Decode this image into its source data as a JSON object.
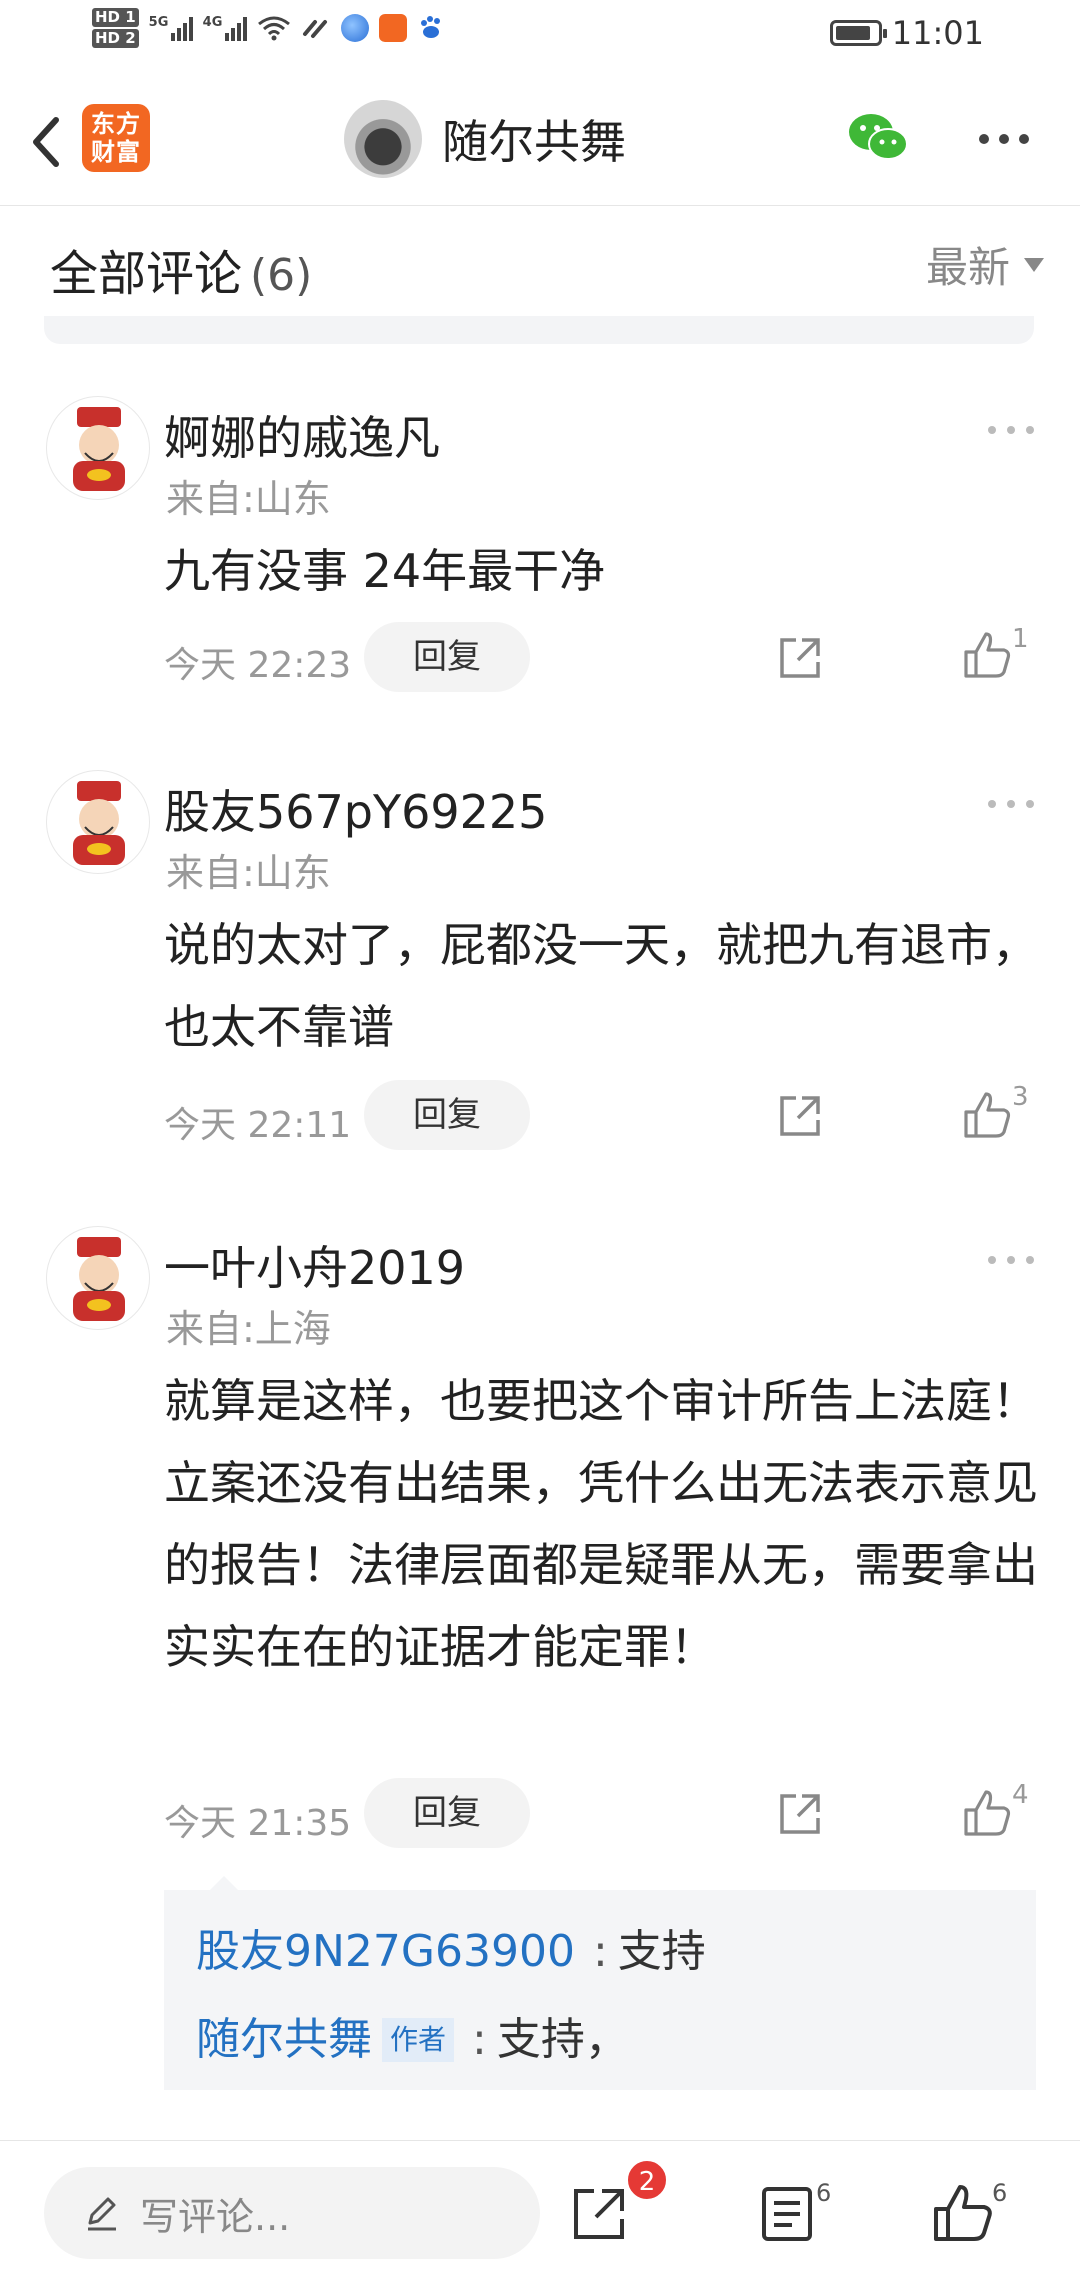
{
  "status_bar": {
    "hd1": "HD 1",
    "hd2": "HD 2",
    "sig1_label": "5G",
    "sig2_label": "4G",
    "time": "11:01"
  },
  "header": {
    "logo_text": "东方财富",
    "title": "随尔共舞"
  },
  "comments_header": {
    "title": "全部评论",
    "count": "(6)",
    "sort_label": "最新"
  },
  "comments": [
    {
      "name": "婀娜的戚逸凡",
      "from": "来自:山东",
      "text": "九有没事  24年最干净",
      "time": "今天 22:23",
      "reply_label": "回复",
      "likes": "1"
    },
    {
      "name": "股友567pY69225",
      "from": "来自:山东",
      "text": "说的太对了，屁都没一天，就把九有退市，也太不靠谱",
      "time": "今天 22:11",
      "reply_label": "回复",
      "likes": "3"
    },
    {
      "name": "一叶小舟2019",
      "from": "来自:上海",
      "text": "就算是这样，也要把这个审计所告上法庭！立案还没有出结果，凭什么出无法表示意见的报告！法律层面都是疑罪从无，需要拿出实实在在的证据才能定罪！",
      "time": "今天 21:35",
      "reply_label": "回复",
      "likes": "4"
    }
  ],
  "replies": [
    {
      "user": "股友9N27G63900",
      "sep": ":",
      "text": "支持"
    },
    {
      "user": "随尔共舞",
      "badge": "作者",
      "sep": ":",
      "text": "支持，"
    }
  ],
  "bottom_bar": {
    "input_placeholder": "写评论...",
    "share_badge": "2",
    "comment_count": "6",
    "like_count": "6"
  },
  "colors": {
    "accent_blue": "#2371c2",
    "brand_orange": "#f26722",
    "badge_red": "#e53935",
    "wechat_green": "#3fb837"
  }
}
